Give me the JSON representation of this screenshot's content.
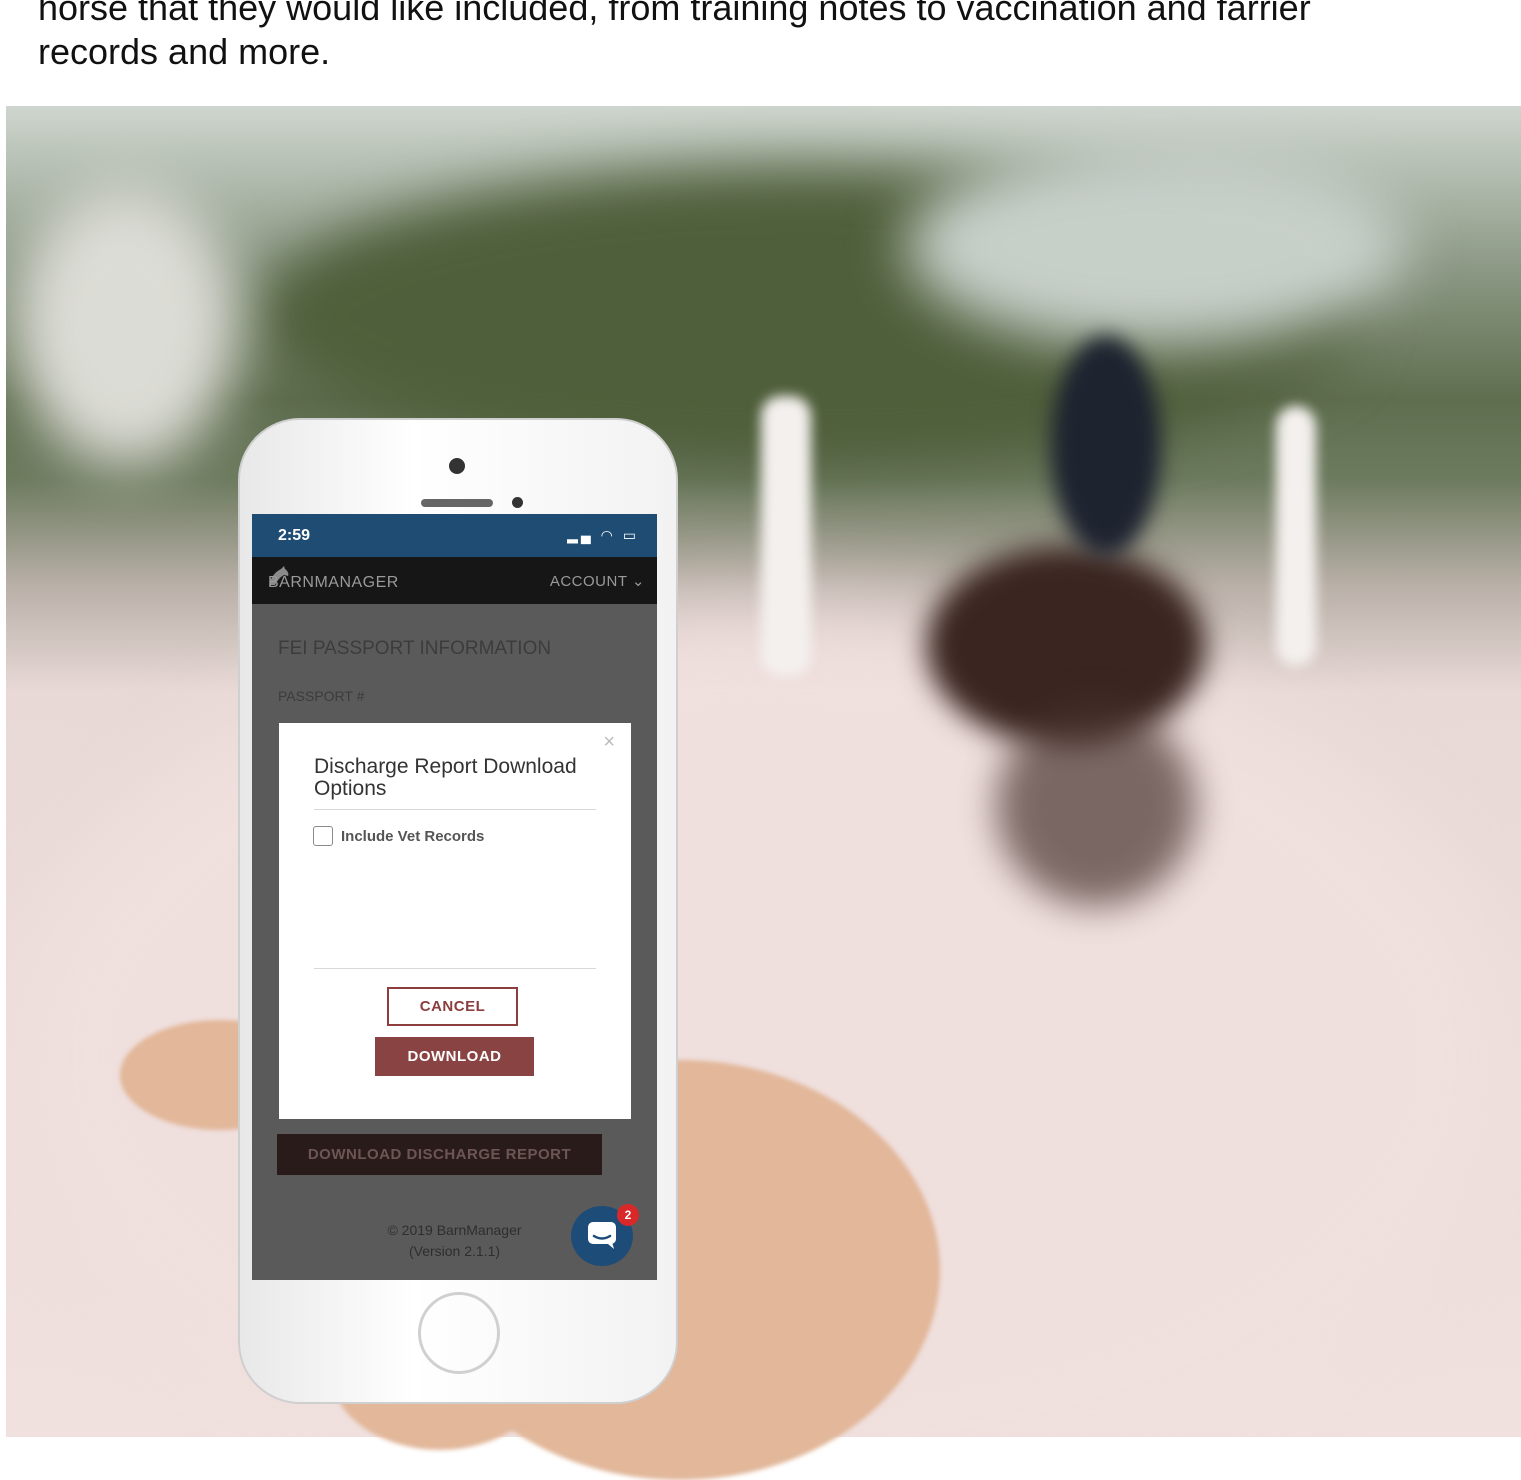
{
  "intro": {
    "line1": "horse that they would like included, from training notes to vaccination and farrier",
    "line2": "records and more."
  },
  "phone": {
    "status_time": "2:59",
    "status_icons": "▂▄ ◠ ▭",
    "app": {
      "logo_text": "BARNMANAGER",
      "account_label": "ACCOUNT",
      "section_title": "FEI PASSPORT INFORMATION",
      "passport_label": "PASSPORT #",
      "modal": {
        "title": "Discharge Report Download Options",
        "close_glyph": "×",
        "checkbox_label": "Include Vet Records",
        "cancel_label": "CANCEL",
        "download_label": "DOWNLOAD"
      },
      "discharge_button_label": "DOWNLOAD DISCHARGE REPORT",
      "footer_line1": "© 2019 BarnManager",
      "footer_line2": "(Version 2.1.1)",
      "chat_badge": "2"
    }
  },
  "colors": {
    "status_bar": "#1f4c73",
    "app_bar": "#161616",
    "accent": "#8a4343",
    "chat_button": "#1e4c78",
    "badge": "#d9282a"
  }
}
